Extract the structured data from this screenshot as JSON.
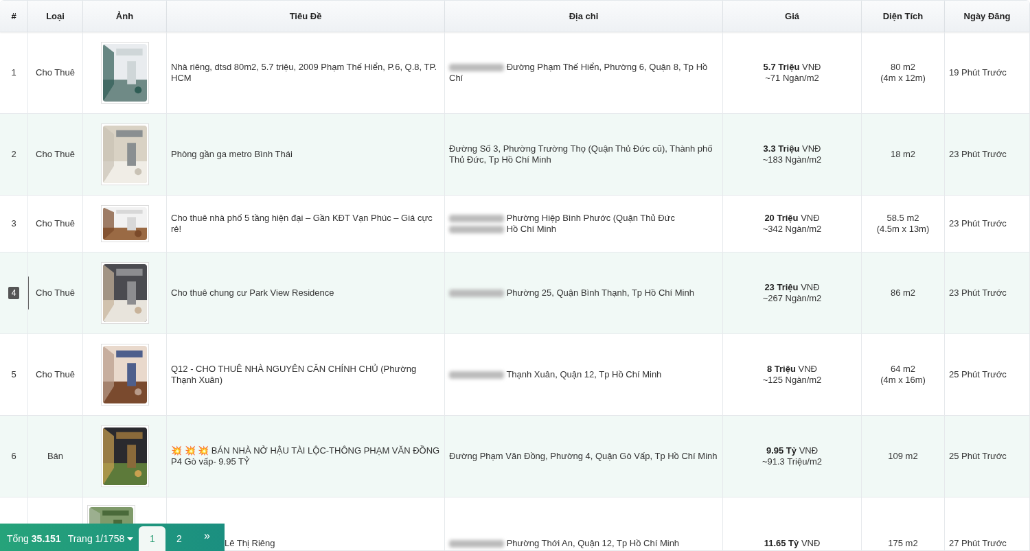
{
  "table": {
    "columns": [
      "#",
      "Loại",
      "Ảnh",
      "Tiêu Đề",
      "Địa chỉ",
      "Giá",
      "Diện Tích",
      "Ngày Đăng"
    ],
    "rows": [
      {
        "number": "1",
        "selected": false,
        "type": "Cho Thuê",
        "image": {
          "kind": "picture"
        },
        "title": "Nhà riêng, dtsd 80m2, 5.7 triệu, 2009 Phạm Thế Hiển, P.6, Q.8, TP. HCM",
        "address": [
          {
            "kind": "blur"
          },
          {
            "kind": "text",
            "text": "Đường Phạm Thế Hiển, Phường 6, Quận 8, Tp Hồ Chí"
          }
        ],
        "price": "**5.7 Triệu** VNĐ",
        "unit_price": "~71 Ngàn/m2",
        "area": "80 m2",
        "dimensions": "(4m x 12m)",
        "posted": "19 Phút Trước"
      },
      {
        "number": "2",
        "selected": false,
        "type": "Cho Thuê",
        "image": {
          "kind": "picture"
        },
        "title": "Phòng gần ga metro Bình Thái",
        "address": [
          {
            "kind": "text",
            "text": "Đường Số 3, Phường Trường Thọ (Quận Thủ Đức cũ), Thành phố Thủ Đức, Tp Hồ Chí Minh"
          }
        ],
        "price": "**3.3 Triệu** VNĐ",
        "unit_price": "~183 Ngàn/m2",
        "area": "18 m2",
        "posted": "23 Phút Trước"
      },
      {
        "number": "3",
        "selected": false,
        "type": "Cho Thuê",
        "image": {
          "kind": "picture"
        },
        "title": "Cho thuê nhà phố 5 tầng hiện đại – Gần KĐT Vạn Phúc – Giá cực rẻ!",
        "address": [
          {
            "kind": "blur"
          },
          {
            "kind": "text",
            "text": "Phường Hiệp Bình Phước (Quận Thủ Đức"
          },
          {
            "kind": "blur"
          },
          {
            "kind": "text",
            "text": "Hồ Chí Minh"
          }
        ],
        "price": "**20 Triệu** VNĐ",
        "unit_price": "~342 Ngàn/m2",
        "area": "58.5 m2",
        "dimensions": "(4.5m x 13m)",
        "posted": "23 Phút Trước"
      },
      {
        "number": "4",
        "selected": true,
        "type": "Cho Thuê",
        "image": {
          "kind": "picture"
        },
        "title": "Cho thuê chung cư Park View Residence",
        "address": [
          {
            "kind": "blur"
          },
          {
            "kind": "text",
            "text": "Phường 25, Quận Bình Thạnh, Tp Hồ Chí Minh"
          }
        ],
        "price": "**23 Triệu** VNĐ",
        "unit_price": "~267 Ngàn/m2",
        "area": "86 m2",
        "posted": "23 Phút Trước"
      },
      {
        "number": "5",
        "selected": false,
        "type": "Cho Thuê",
        "image": {
          "kind": "picture"
        },
        "title": "Q12 - CHO THUÊ NHÀ NGUYÊN CĂN CHÍNH CHỦ (Phường Thạnh Xuân)",
        "address": [
          {
            "kind": "blur"
          },
          {
            "kind": "text",
            "text": "Thạnh Xuân, Quận 12, Tp Hồ Chí Minh"
          }
        ],
        "price": "**8 Triệu** VNĐ",
        "unit_price": "~125 Ngàn/m2",
        "area": "64 m2",
        "dimensions": "(4m x 16m)",
        "posted": "25 Phút Trước"
      },
      {
        "number": "6",
        "selected": false,
        "type": "Bán",
        "image": {
          "kind": "picture"
        },
        "title": "💥 💥 💥  BÁN NHÀ NỞ HẬU TÀI LỘC-THÔNG PHẠM VĂN ĐỒNG P4 Gò vấp- 9.95 TỶ",
        "address": [
          {
            "kind": "text",
            "text": "Đường Phạm Văn Đồng, Phường 4, Quận Gò Vấp, Tp Hồ Chí Minh"
          }
        ],
        "price": "**9.95 Tỷ** VNĐ",
        "unit_price": "~91.3 Triệu/m2",
        "area": "109 m2",
        "posted": "25 Phút Trước"
      },
      {
        "image": {
          "kind": "picture"
        },
        "title": "Lê Thị Riêng",
        "address": [
          {
            "kind": "blur"
          },
          {
            "kind": "text",
            "text": "Phường Thới An, Quận 12, Tp Hồ Chí Minh"
          }
        ],
        "price": "**11.65 Tỷ** VNĐ",
        "area": "175 m2",
        "posted": "27 Phút Trước"
      }
    ]
  },
  "pager": {
    "total": "Tổng **35.151**",
    "page_select": "Trang 1/1758",
    "pages": [
      {
        "label": "1",
        "selected": true
      },
      {
        "label": "2",
        "selected": false
      }
    ],
    "next": "»"
  }
}
